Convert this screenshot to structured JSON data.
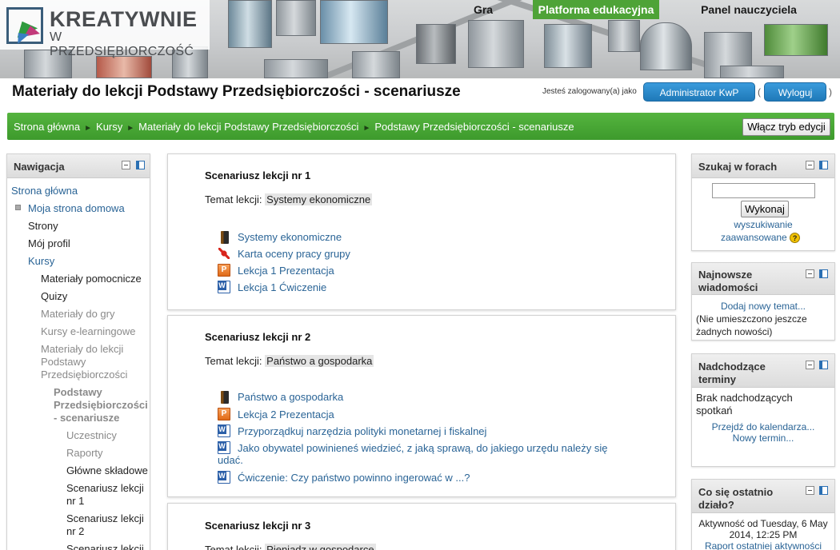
{
  "header": {
    "logo_title": "KREATYWNIE",
    "logo_subtitle": "W PRZEDSIĘBIORCZOŚĆ",
    "nav": [
      "Gra",
      "Platforma edukacyjna",
      "Panel nauczyciela"
    ],
    "active_nav": "Platforma edukacyjna"
  },
  "page": {
    "title": "Materiały do lekcji Podstawy Przedsiębiorczości - scenariusze",
    "logged_in_label": "Jesteś zalogowany(a) jako",
    "user_button": "Administrator KwP",
    "logout_button": "Wyloguj",
    "paren_open": "(",
    "paren_close": ")"
  },
  "breadcrumb": {
    "items": [
      "Strona główna",
      "Kursy",
      "Materiały do lekcji Podstawy Przedsiębiorczości",
      "Podstawy Przedsiębiorczości - scenariusze"
    ],
    "separator": "►",
    "edit_button": "Włącz tryb edycji"
  },
  "navigation": {
    "title": "Nawigacja",
    "items": {
      "home": "Strona główna",
      "my_home": "Moja strona domowa",
      "pages": "Strony",
      "profile": "Mój profil",
      "courses": "Kursy",
      "aux": "Materiały pomocnicze",
      "quizzes": "Quizy",
      "game": "Materiały do gry",
      "elearning": "Kursy e-learningowe",
      "lesson_l1": "Materiały do lekcji",
      "lesson_l2": "Podstawy",
      "lesson_l3": "Przedsiębiorczości",
      "scen_l1": "Podstawy",
      "scen_l2": "Przedsiębiorczości",
      "scen_l3": "- scenariusze",
      "participants": "Uczestnicy",
      "reports": "Raporty",
      "components": "Główne składowe",
      "s1_l1": "Scenariusz lekcji",
      "s1_l2": "nr 1",
      "s2_l1": "Scenariusz lekcji",
      "s2_l2": "nr 2",
      "s3_l1": "Scenariusz lekcji"
    }
  },
  "sections": [
    {
      "title": "Scenariusz lekcji nr 1",
      "topic_label": "Temat lekcji:",
      "topic": "Systemy ekonomiczne",
      "resources": [
        {
          "icon": "book-icon",
          "label": "Systemy ekonomiczne"
        },
        {
          "icon": "pdf-icon",
          "label": "Karta oceny pracy grupy"
        },
        {
          "icon": "ppt-icon",
          "label": "Lekcja 1 Prezentacja"
        },
        {
          "icon": "word-icon",
          "label": "Lekcja 1 Ćwiczenie"
        }
      ]
    },
    {
      "title": "Scenariusz lekcji nr 2",
      "topic_label": "Temat lekcji:",
      "topic": "Państwo a gospodarka",
      "resources": [
        {
          "icon": "book-icon",
          "label": "Państwo a gospodarka"
        },
        {
          "icon": "ppt-icon",
          "label": "Lekcja 2 Prezentacja"
        },
        {
          "icon": "word-icon",
          "label": "Przyporządkuj narzędzia polityki monetarnej i fiskalnej"
        },
        {
          "icon": "word-icon",
          "label_l1": "Jako obywatel powinieneś wiedzieć, z jaką sprawą, do jakiego urzędu należy się",
          "label_l2": "udać."
        },
        {
          "icon": "word-icon",
          "label": "Ćwiczenie: Czy państwo powinno ingerować w ...?"
        }
      ]
    },
    {
      "title": "Scenariusz lekcji nr 3",
      "topic_label": "Temat lekcji:",
      "topic": "Pieniądz w gospodarce"
    }
  ],
  "search_block": {
    "title": "Szukaj w forach",
    "input_value": "",
    "button": "Wykonaj",
    "advanced_l1": "wyszukiwanie",
    "advanced_l2": "zaawansowane",
    "help": "?"
  },
  "news_block": {
    "title_l1": "Najnowsze",
    "title_l2": "wiadomości",
    "add_link": "Dodaj nowy temat...",
    "empty_l1": "(Nie umieszczono jeszcze",
    "empty_l2": "żadnych nowości)"
  },
  "events_block": {
    "title_l1": "Nadchodzące",
    "title_l2": "terminy",
    "empty_l1": "Brak nadchodzących",
    "empty_l2": "spotkań",
    "calendar_link": "Przejdź do kalendarza...",
    "new_event_link": "Nowy termin..."
  },
  "activity_block": {
    "title_l1": "Co się ostatnio",
    "title_l2": "działo?",
    "since_l1": "Aktywność od Tuesday, 6 May",
    "since_l2": "2014, 12:25 PM",
    "report_link": "Raport ostatniej aktywności"
  },
  "colors": {
    "green": "#4ea337",
    "link_blue": "#2a6496",
    "button_blue": "#1f79b8"
  }
}
